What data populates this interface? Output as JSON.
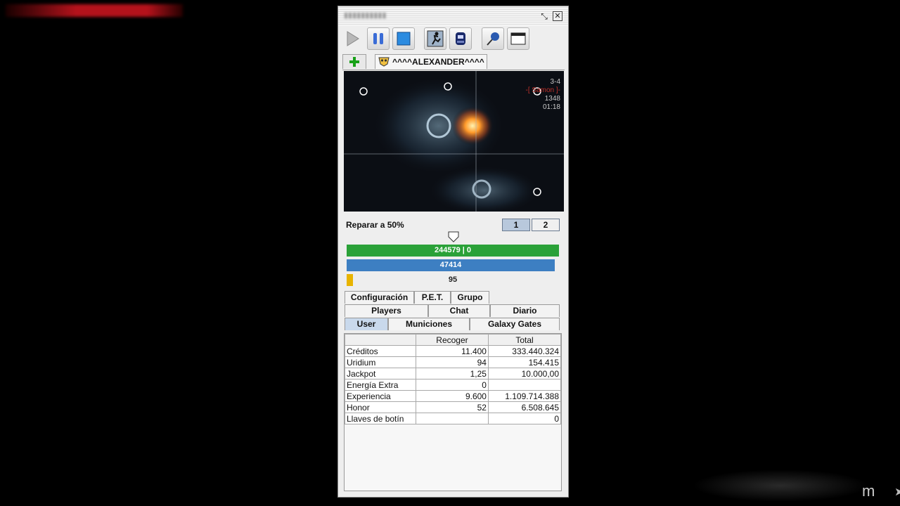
{
  "window": {
    "player_tab_label": "^^^^ALEXANDER^^^^"
  },
  "toolbar": {
    "icons": [
      "play-icon",
      "pause-icon",
      "stop-icon",
      "runner-icon",
      "ship-icon",
      "pin-icon",
      "window-icon"
    ]
  },
  "map": {
    "map_name": "3-4",
    "enemy_label": "-[ Samon ]-",
    "coord_value": "1348",
    "timer": "01:18"
  },
  "repair": {
    "label": "Reparar a 50%",
    "config_1": "1",
    "config_2": "2"
  },
  "bars": {
    "hp_text": "244579 | 0",
    "shield_text": "47414",
    "cargo_text": "95",
    "cargo_level_percent": 3,
    "colors": {
      "hp": "#2aa138",
      "shield": "#3d7fc2",
      "cargo": "#e8b400"
    }
  },
  "tabs": {
    "row1": [
      "Configuración",
      "P.E.T.",
      "Grupo"
    ],
    "row2": [
      "Players",
      "Chat",
      "Diario"
    ],
    "row3": [
      "User",
      "Municiones",
      "Galaxy Gates"
    ],
    "active": "User"
  },
  "stats": {
    "headers": [
      "",
      "Recoger",
      "Total"
    ],
    "rows": [
      [
        "Créditos",
        "11.400",
        "333.440.324"
      ],
      [
        "Uridium",
        "94",
        "154.415"
      ],
      [
        "Jackpot",
        "1,25",
        "10.000,00"
      ],
      [
        "Energía Extra",
        "0",
        ""
      ],
      [
        "Experiencia",
        "9.600",
        "1.109.714.388"
      ],
      [
        "Honor",
        "52",
        "6.508.645"
      ],
      [
        "Llaves de botín",
        "",
        "0"
      ]
    ]
  },
  "corner_text": "m"
}
